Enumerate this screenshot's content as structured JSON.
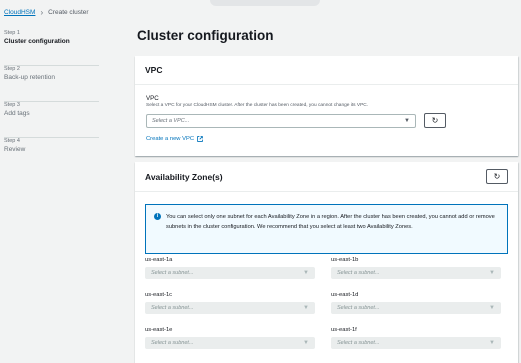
{
  "breadcrumb": {
    "root": "CloudHSM",
    "current": "Create cluster"
  },
  "steps": [
    {
      "num": "Step 1",
      "title": "Cluster configuration",
      "active": true
    },
    {
      "num": "Step 2",
      "title": "Back-up retention",
      "active": false
    },
    {
      "num": "Step 3",
      "title": "Add tags",
      "active": false
    },
    {
      "num": "Step 4",
      "title": "Review",
      "active": false
    }
  ],
  "page_title": "Cluster configuration",
  "vpc": {
    "heading": "VPC",
    "label": "VPC",
    "description": "Select a VPC for your CloudHSM cluster. After the cluster has been created, you cannot change its VPC.",
    "placeholder": "Select a VPC...",
    "refresh_icon": "refresh-icon",
    "create_link": "Create a new VPC",
    "external_icon": "external-link-icon"
  },
  "az": {
    "heading": "Availability Zone(s)",
    "info": "You can select only one subnet for each Availability Zone in a region. After the cluster has been created, you cannot add or remove subnets in the cluster configuration. We recommend that you select at least two Availability Zones.",
    "zones": [
      {
        "label": "us-east-1a",
        "placeholder": "Select a subnet..."
      },
      {
        "label": "us-east-1b",
        "placeholder": "Select a subnet..."
      },
      {
        "label": "us-east-1c",
        "placeholder": "Select a subnet..."
      },
      {
        "label": "us-east-1d",
        "placeholder": "Select a subnet..."
      },
      {
        "label": "us-east-1e",
        "placeholder": "Select a subnet..."
      },
      {
        "label": "us-east-1f",
        "placeholder": "Select a subnet..."
      }
    ]
  },
  "colors": {
    "link": "#0073bb",
    "background": "#f2f3f3",
    "panel": "#ffffff",
    "info_border": "#0073bb",
    "info_bg": "#f1faff"
  }
}
